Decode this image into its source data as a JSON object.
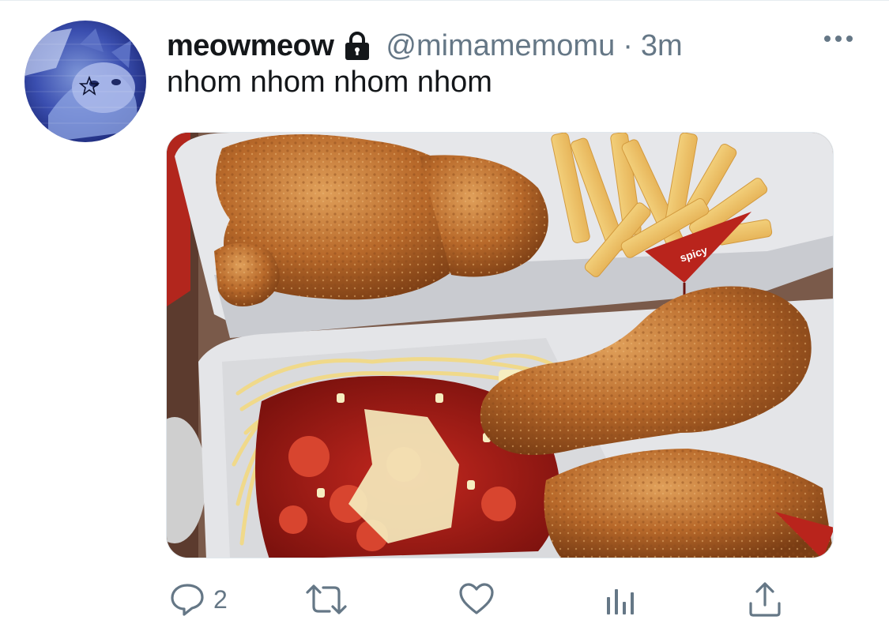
{
  "tweet": {
    "display_name": "meowmeow",
    "handle": "@mimamemomu",
    "separator": "·",
    "time": "3m",
    "text": "nhom nhom nhom nhom",
    "protected_icon": "lock-icon",
    "more_icon": "more-horizontal-icon"
  },
  "media": {
    "flag_label": "spicy"
  },
  "actions": {
    "reply": {
      "icon": "reply-icon",
      "count": "2"
    },
    "retweet": {
      "icon": "retweet-icon"
    },
    "like": {
      "icon": "heart-icon"
    },
    "analytics": {
      "icon": "analytics-icon"
    },
    "share": {
      "icon": "share-icon"
    }
  },
  "colors": {
    "text_primary": "#14171a",
    "text_secondary": "#657786",
    "icon": "#657786"
  }
}
